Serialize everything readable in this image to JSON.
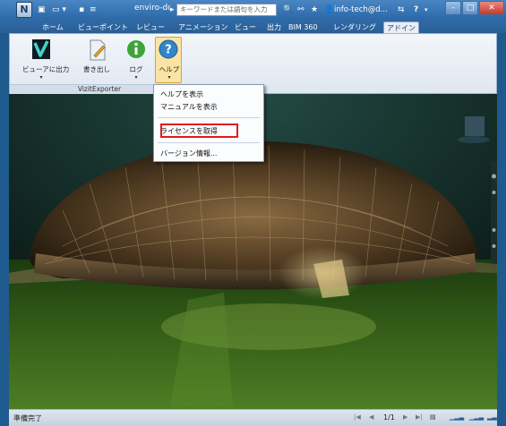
{
  "titlebar": {
    "qat": [
      "▣",
      "▭ ▾",
      "▪",
      "≡"
    ],
    "title": "enviro-do...",
    "search_placeholder": "キーワードまたは語句を入力",
    "icons": [
      "binoculars-icon",
      "star-icon",
      "user-icon",
      "help-icon"
    ],
    "user": "info-tech@d...",
    "help": "?"
  },
  "tabs": [
    {
      "label": "ホーム"
    },
    {
      "label": "ビューポイント"
    },
    {
      "label": "レビュー"
    },
    {
      "label": "アニメーション"
    },
    {
      "label": "ビュー"
    },
    {
      "label": "出力"
    },
    {
      "label": "BIM 360"
    },
    {
      "label": "レンダリング"
    },
    {
      "label": "アドイン"
    }
  ],
  "ribbon": {
    "buttons": [
      {
        "label": "ビューアに出力",
        "has_dropdown": true
      },
      {
        "label": "書き出し",
        "has_dropdown": false
      },
      {
        "label": "ログ",
        "has_dropdown": true
      },
      {
        "label": "ヘルプ",
        "has_dropdown": true
      }
    ],
    "group_label": "VizitExporter"
  },
  "menu": {
    "items": [
      {
        "label": "ヘルプを表示"
      },
      {
        "label": "マニュアルを表示"
      },
      {
        "label": "ライセンスを取得"
      },
      {
        "label": "バージョン情報..."
      }
    ]
  },
  "statusbar": {
    "status": "準備完了",
    "page": "1/1"
  },
  "colors": {
    "accent": "#2b68a8",
    "highlight_border": "#e01d1d",
    "viewport_bg": "#0a1814"
  }
}
